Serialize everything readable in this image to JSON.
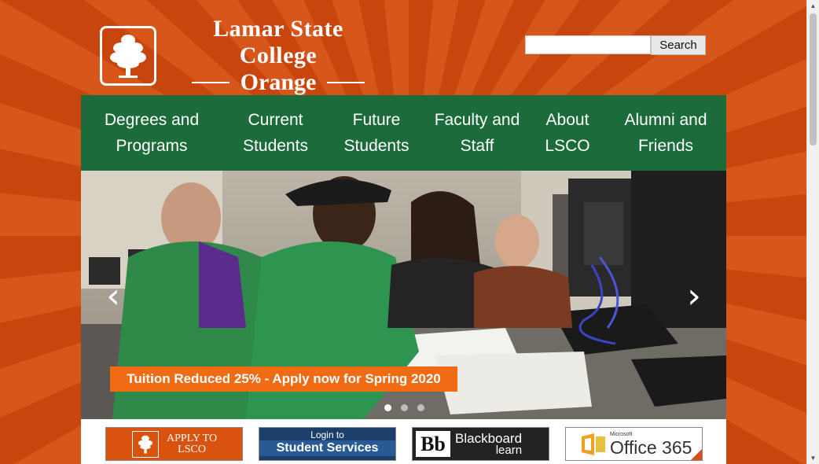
{
  "header": {
    "college_name": "Lamar State College",
    "campus_name": "Orange",
    "logo_icon": "tree-icon"
  },
  "search": {
    "placeholder": "",
    "button_label": "Search"
  },
  "nav": {
    "items": [
      {
        "label": "Degrees and Programs"
      },
      {
        "label": "Current Students"
      },
      {
        "label": "Future Students"
      },
      {
        "label": "Faculty and Staff"
      },
      {
        "label": "About LSCO"
      },
      {
        "label": "Alumni and Friends"
      }
    ]
  },
  "slider": {
    "caption": "Tuition Reduced 25% - Apply now for Spring 2020",
    "prev_icon": "chevron-left-icon",
    "next_icon": "chevron-right-icon",
    "slide_count": 3,
    "active_slide": 1
  },
  "quick_links": {
    "apply": {
      "line1": "APPLY TO",
      "line2": "LSCO"
    },
    "login": {
      "line1": "Login to",
      "line2": "Student Services"
    },
    "blackboard": {
      "logo": "Bb",
      "line1": "Blackboard",
      "line2": "learn"
    },
    "office": {
      "line1": "Microsoft",
      "line2": "Office 365"
    }
  },
  "colors": {
    "brand_orange": "#d7561a",
    "nav_green": "#1c6c3b",
    "caption_orange": "#f06b14"
  }
}
